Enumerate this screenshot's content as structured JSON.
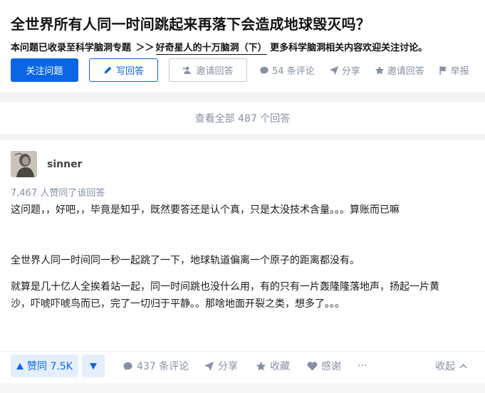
{
  "question": {
    "title": "全世界所有人同一时间跳起来再落下会造成地球毁灭吗？",
    "topic_prefix": "本问题已收录至科学脑洞专题",
    "topic_sep": "＞＞",
    "topic_link": "好奇星人的十万脑洞（下）",
    "topic_suffix": "更多科学脑洞相关内容欢迎关注讨论。"
  },
  "actions": {
    "follow": "关注问题",
    "write_answer": "写回答",
    "invite": "邀请回答",
    "comments": "54 条评论",
    "share": "分享",
    "invite2": "邀请回答",
    "report": "举报"
  },
  "view_all": "查看全部 487 个回答",
  "answer": {
    "author": "sinner",
    "votes_text": "7,467 人赞同了该回答",
    "para1": "这问题，，好吧，，毕竟是知乎，既然要答还是认个真，只是太没技术含量。。。算账而已嘛",
    "para2": "全世界人同一时间同一秒一起跳了一下，地球轨道偏离一个原子的距离都没有。",
    "para3_line1": "就算是几十亿人全挨着站一起，同一时间跳也没什么用，有的只有一片轰隆隆落地声，扬起一片黄",
    "para3_line2": "沙，吓唬吓唬鸟而已，完了一切归于平静。。那啥地面开裂之类，想多了。。。"
  },
  "footer": {
    "vote_up": "赞同 7.5K",
    "comments": "437 条评论",
    "share": "分享",
    "collect": "收藏",
    "thanks": "感谢",
    "more": "···",
    "collapse": "收起"
  },
  "colors": {
    "primary": "#0a66e6",
    "meta": "#8590a6",
    "vote_bg": "#e5effc"
  }
}
